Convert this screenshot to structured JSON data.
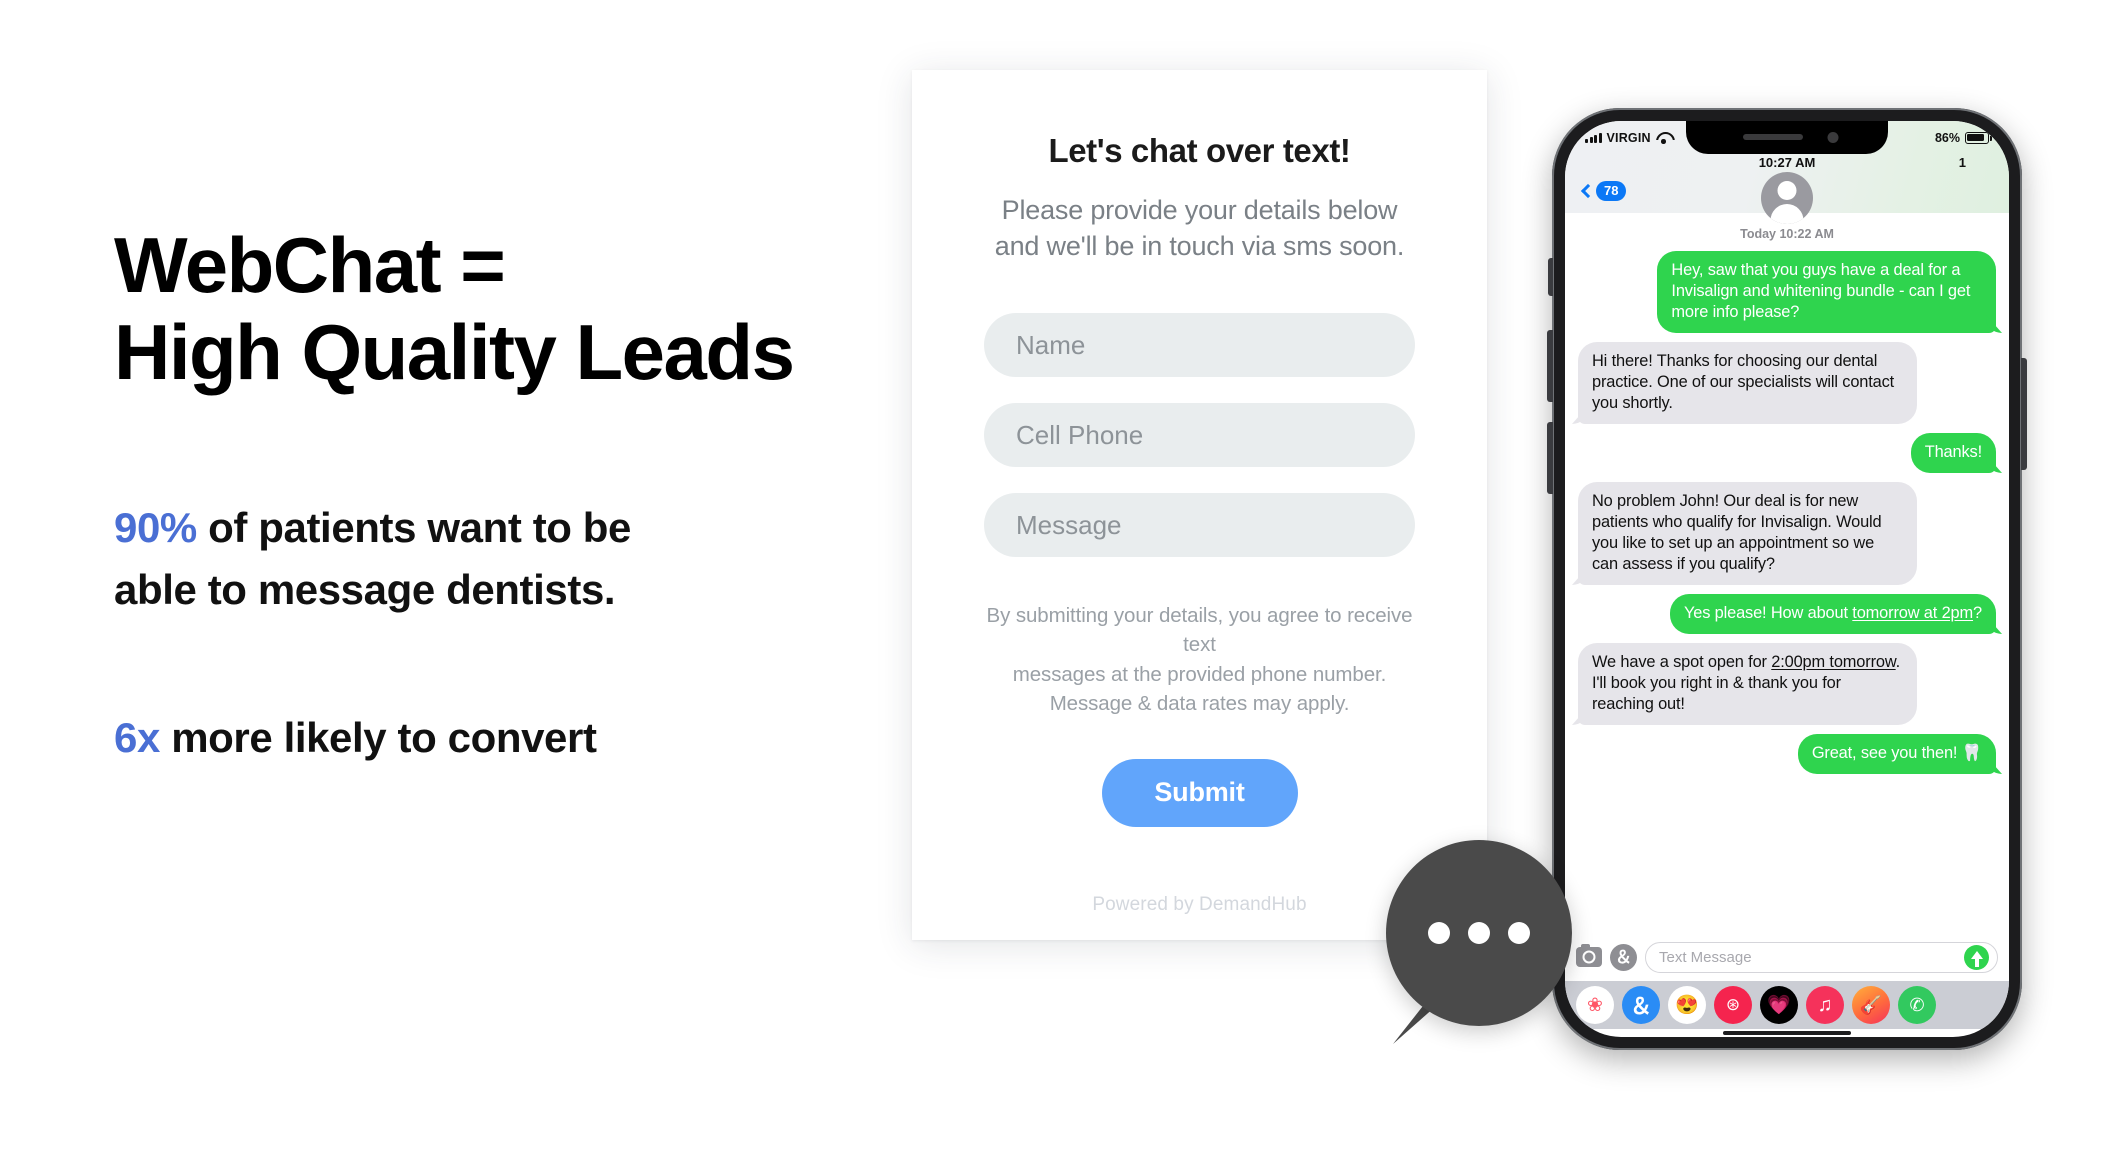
{
  "marketing": {
    "headline_line1": "WebChat =",
    "headline_line2": "High Quality Leads",
    "accent_color": "#4a6fd4",
    "stat1_value": "90%",
    "stat1_text_a": " of patients want to be",
    "stat1_text_b": "able to message dentists.",
    "stat2_value": "6x",
    "stat2_text": " more likely to convert"
  },
  "webchat_form": {
    "title": "Let's chat over text!",
    "subtitle_line1": "Please provide your details below",
    "subtitle_line2": "and we'll be in touch via sms soon.",
    "name_placeholder": "Name",
    "phone_placeholder": "Cell Phone",
    "message_placeholder": "Message",
    "disclaimer_line1": "By submitting your details, you agree to receive text",
    "disclaimer_line2": "messages at the provided phone number.",
    "disclaimer_line3": "Message & data rates may apply.",
    "submit_label": "Submit",
    "submit_color": "#61a5fb",
    "powered_by": "Powered by DemandHub"
  },
  "chat_widget": {
    "icon": "chat-dots",
    "color": "#4a4a4a"
  },
  "phone": {
    "status_bar": {
      "carrier": "VIRGIN",
      "signal_icon": "signal-bars-icon",
      "wifi_icon": "wifi-icon",
      "battery_percent": "86%",
      "battery_icon": "battery-icon"
    },
    "chat_header": {
      "time": "10:27 AM",
      "right_count": "1",
      "back_badge": "78",
      "back_icon": "chevron-left-icon",
      "avatar_icon": "person-avatar-icon"
    },
    "conversation": {
      "daystamp": "Today 10:22 AM",
      "messages": [
        {
          "side": "out",
          "text": "Hey, saw that you guys have a deal for a Invisalign and whitening bundle - can I get more info please?"
        },
        {
          "side": "in",
          "text": "Hi there! Thanks for choosing our dental practice. One of our specialists will contact you shortly."
        },
        {
          "side": "out",
          "text": "Thanks!"
        },
        {
          "side": "in",
          "text": "No problem John! Our deal is for new patients who qualify for Invisalign. Would you like to set up an appointment so we can assess if you qualify?"
        },
        {
          "side": "out",
          "text_pre": "Yes please! How about ",
          "text_link": "tomorrow at 2pm",
          "text_post": "?"
        },
        {
          "side": "in",
          "text_pre": "We have a spot open for ",
          "text_link": "2:00pm tomorrow",
          "text_post": ". I'll book you right in & thank you for reaching out!"
        },
        {
          "side": "out",
          "text": "Great, see you then! 🦷"
        }
      ]
    },
    "input_bar": {
      "camera_icon": "camera-icon",
      "appstore_icon": "app-store-icon",
      "placeholder": "Text Message",
      "send_icon": "send-arrow-up-icon",
      "send_color": "#2fd44e"
    },
    "dock": {
      "apps": [
        {
          "name": "photos-app-icon",
          "glyph": "❀"
        },
        {
          "name": "app-store-app-icon",
          "glyph": "A"
        },
        {
          "name": "memoji-app-icon",
          "glyph": "😍"
        },
        {
          "name": "images-search-app-icon",
          "glyph": "⊛"
        },
        {
          "name": "digital-touch-app-icon",
          "glyph": "💗"
        },
        {
          "name": "music-app-icon",
          "glyph": "♫"
        },
        {
          "name": "garageband-app-icon",
          "glyph": "🎸"
        },
        {
          "name": "green-app-icon",
          "glyph": "✆"
        }
      ]
    }
  }
}
